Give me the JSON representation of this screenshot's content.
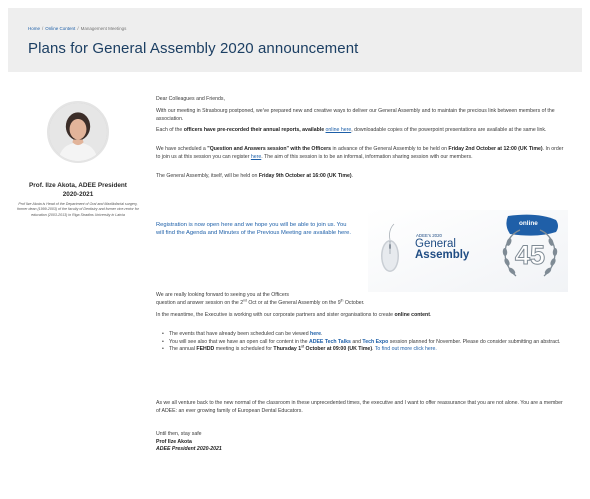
{
  "breadcrumb": {
    "items": [
      "Home",
      "Online Content",
      "Management Meetings"
    ],
    "separator": "/"
  },
  "page": {
    "title": "Plans for General Assembly 2020 announcement"
  },
  "profile": {
    "name_line1": "Prof. Ilze Akota, ADEE President",
    "name_line2": "2020-2021",
    "bio": "Prof Ilze Akota is Head of the Department of Oral and Maxillofacial surgery, former dean (1999-2003) of the faculty of Dentistry and former vice-rector for education (2003-2013) in Riga Stradins University in Latvia"
  },
  "letter": {
    "greeting": "Dear Colleagues and Friends,",
    "p1": "With our meeting in Strasbourg postponed, we've prepared new and creative ways to deliver our General Assembly and to maintain the precious link between members of the association.",
    "p2_pre": "Each of the ",
    "p2_bold": "officers have pre-recorded their annual reports, available ",
    "p2_link": "online here",
    "p2_post": ", downloadable copies of the powerpoint presentations are available at the same link.",
    "p3_pre": "We have scheduled a ",
    "p3_bold1": "\"Question and Answers session\" with the Officers",
    "p3_mid1": " in advance of the General Assembly to be held on ",
    "p3_bold2": "Friday 2nd October at 12:00 (UK Time)",
    "p3_mid2": ". In order to join us at this session you can register ",
    "p3_link": "here",
    "p3_post": ". The aim of this session is to be an informal, information sharing session with our members.",
    "p4_pre": "The General Assembly, itself, will be held on ",
    "p4_bold": "Friday 9th October at 16:00 (UK Time)",
    "p4_post": ".",
    "registration": "Registration is now open here and we hope you will be able to join us. You will find the Agenda and Minutes of the Previous Meeting are available here.",
    "p5_a": "We are really looking forward to seeing you at the Officers",
    "p5_b_pre": "question and answer session on the 2",
    "p5_b_sup1": "nd",
    "p5_b_mid": " Oct or at the General Assembly on the 9",
    "p5_b_sup2": "th",
    "p5_b_post": " October.",
    "p6_pre": "In the meantime, the Executive is working with our corporate partners and sister organisations to create ",
    "p6_bold": "online content",
    "p6_post": ".",
    "b1_pre": "The events that have already been scheduled can be viewed ",
    "b1_link": "here",
    "b1_post": ".",
    "b2_pre": "You will see also that we have an open call for content in the ",
    "b2_link1": "ADEE Tech Talks",
    "b2_and": " and ",
    "b2_link2": "Tech Expo",
    "b2_post": " session planned for November. Please do consider submitting an abstract.",
    "b3_pre": "The annual ",
    "b3_bold1": "FEHDD",
    "b3_mid": " meeting is scheduled for ",
    "b3_bold2": "Thursday 1",
    "b3_sup": "st",
    "b3_bold3": " October at 09:00 (UK Time)",
    "b3_dot": ". ",
    "b3_link": "To find out more click here.",
    "p7": "As we all venture back to the new normal of the classroom in these unprecedented times, the executive and I want to offer reassurance that you are not alone. You are a member of ADEE: an ever growing family of European Dental Educators.",
    "closing": "Until then, stay safe",
    "sign_name": "Prof Ilze Akota",
    "sign_role": "ADEE President 2020-2021"
  },
  "banner": {
    "small_label": "ADEE's 2020",
    "line1": "General",
    "line2": "Assembly",
    "badge": "online",
    "number": "45",
    "colors": {
      "badge": "#1f5fa8",
      "text": "#1f4c83",
      "laurel": "#7f8b95"
    }
  }
}
